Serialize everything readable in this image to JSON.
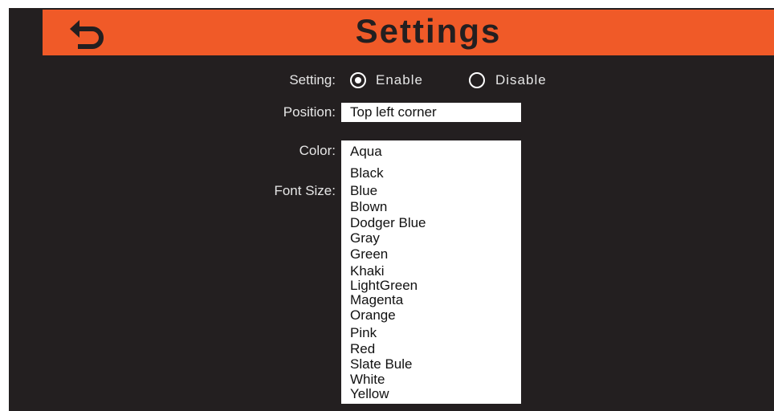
{
  "header": {
    "title": "Settings",
    "back_icon": "back-arrow-icon"
  },
  "form": {
    "setting_label": "Setting:",
    "setting_options": [
      {
        "label": "Enable",
        "selected": true
      },
      {
        "label": "Disable",
        "selected": false
      }
    ],
    "position_label": "Position:",
    "position_value": "Top left corner",
    "color_label": "Color:",
    "font_size_label": "Font Size:"
  },
  "color_dropdown": {
    "options": [
      "Aqua",
      "Black",
      "Blue",
      "Blown",
      "Dodger Blue",
      "Gray",
      "Green",
      "Khaki",
      "LightGreen",
      "Magenta",
      "Orange",
      "Pink",
      "Red",
      "Slate Bule",
      "White",
      "Yellow"
    ]
  },
  "colors": {
    "header": "#f05a28",
    "background": "#231f20",
    "text": "#e6e6e6"
  }
}
